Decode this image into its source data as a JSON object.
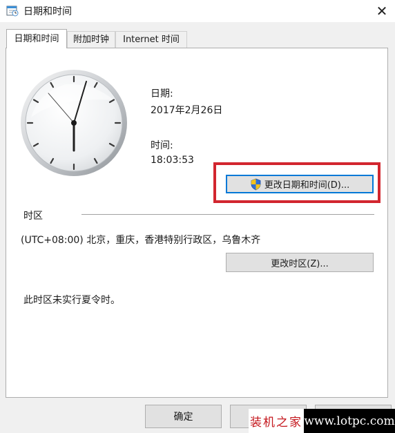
{
  "window": {
    "title": "日期和时间",
    "close_glyph": "✕"
  },
  "tabs": [
    {
      "label": "日期和时间",
      "active": true
    },
    {
      "label": "附加时钟",
      "active": false
    },
    {
      "label": "Internet 时间",
      "active": false
    }
  ],
  "date": {
    "label": "日期:",
    "value": "2017年2月26日"
  },
  "time": {
    "label": "时间:",
    "value": "18:03:53"
  },
  "change_datetime_button": "更改日期和时间(D)...",
  "timezone": {
    "section_label": "时区",
    "value": "(UTC+08:00) 北京，重庆，香港特别行政区，乌鲁木齐",
    "change_button": "更改时区(Z)...",
    "dst_note": "此时区未实行夏令时。"
  },
  "footer": {
    "ok_label": "确定"
  },
  "watermark": {
    "left_text": "装机之家",
    "right_text": "www.lotpc.com"
  },
  "colors": {
    "highlight_box": "#d2262f",
    "focus_border": "#0078d7",
    "watermark_red": "#c4161c"
  },
  "icons": [
    "date-time-app-icon",
    "close-icon",
    "uac-shield-icon",
    "analog-clock"
  ]
}
